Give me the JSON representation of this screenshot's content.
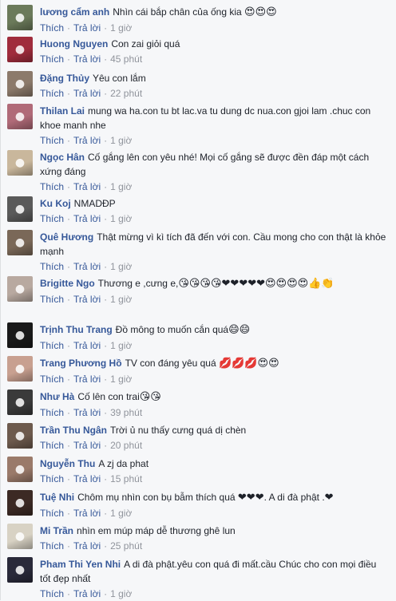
{
  "actions": {
    "like_label": "Thích",
    "reply_label": "Trả lời",
    "separator": "·"
  },
  "comments": [
    {
      "name": "lương cẩm anh",
      "text": "Nhìn cái bắp chân của ống kia",
      "emoji": "😍😍😍",
      "time": "1 giờ",
      "avatar_color": "#6b7a5a",
      "avatar_icon": "user-avatar-icon"
    },
    {
      "name": "Huong Nguyen",
      "text": "Con zai giỏi quá",
      "emoji": "",
      "time": "45 phút",
      "avatar_color": "#a02c3c",
      "avatar_icon": "user-avatar-icon"
    },
    {
      "name": "Đặng Thủy",
      "text": "Yêu con lắm",
      "emoji": "",
      "time": "22 phút",
      "avatar_color": "#8c7a6b",
      "avatar_icon": "user-avatar-icon"
    },
    {
      "name": "Thilan Lai",
      "text": "mung wa ha.con tu bt lac.va tu dung dc nua.con gjoi lam .chuc con khoe manh nhe",
      "emoji": "",
      "time": "1 giờ",
      "avatar_color": "#b06a78",
      "avatar_icon": "user-avatar-icon"
    },
    {
      "name": "Ngọc Hân",
      "text": "Cố gắng lên con yêu nhé! Mọi cố gắng sẽ được đền đáp một cách xứng đáng",
      "emoji": "",
      "time": "1 giờ",
      "avatar_color": "#c9b79c",
      "avatar_icon": "user-avatar-icon"
    },
    {
      "name": "Ku Koj",
      "text": "NMADĐP",
      "emoji": "",
      "time": "1 giờ",
      "avatar_color": "#5a5a5a",
      "avatar_icon": "user-avatar-icon"
    },
    {
      "name": "Quê Hương",
      "text": "Thật mừng vì kì tích đã đến với con. Cầu mong cho con thật là khỏe mạnh",
      "emoji": "",
      "time": "1 giờ",
      "avatar_color": "#7a6858",
      "avatar_icon": "user-avatar-icon"
    },
    {
      "name": "Brigitte Ngo",
      "text": "Thương e ,cưng e,",
      "emoji": "😘😘😘😘❤❤❤❤❤😍😍😍😍👍👏",
      "time": "1 giờ",
      "avatar_color": "#b8a9a0",
      "avatar_icon": "user-avatar-icon"
    },
    {
      "name": "Trịnh Thu Trang",
      "text": "Đồ mông to muốn cắn quá",
      "emoji": "😄😄",
      "time": "1 giờ",
      "avatar_color": "#1a1a1a",
      "avatar_icon": "user-avatar-icon"
    },
    {
      "name": "Trang Phương Hồ",
      "text": "TV con đáng yêu quá",
      "emoji": "💋💋💋😍😍",
      "time": "1 giờ",
      "avatar_color": "#c8a090",
      "avatar_icon": "user-avatar-icon"
    },
    {
      "name": "Như Hà",
      "text": "Cố lên con trai",
      "emoji": "😘😘",
      "time": "39 phút",
      "avatar_color": "#3a3a3a",
      "avatar_icon": "user-avatar-icon"
    },
    {
      "name": "Trần Thu Ngân",
      "text": "Trời ủ nu thấy cưng quá dị chèn",
      "emoji": "",
      "time": "20 phút",
      "avatar_color": "#6d5a4d",
      "avatar_icon": "user-avatar-icon"
    },
    {
      "name": "Nguyễn Thu",
      "text": "A zj da phat",
      "emoji": "",
      "time": "15 phút",
      "avatar_color": "#9a7a6a",
      "avatar_icon": "user-avatar-icon"
    },
    {
      "name": "Tuệ Nhi",
      "text": "Chôm mụ nhìn con bụ bẫm thích quá",
      "emoji": "❤❤❤",
      "text2": ". A di đà phật .",
      "emoji2": "❤",
      "time": "1 giờ",
      "avatar_color": "#3c2a24",
      "avatar_icon": "user-avatar-icon"
    },
    {
      "name": "Mi Trần",
      "text": "nhìn em múp máp dễ thương ghê lun",
      "emoji": "",
      "time": "25 phút",
      "avatar_color": "#d8d2c4",
      "avatar_icon": "user-avatar-icon"
    },
    {
      "name": "Pham Thi Yen Nhi",
      "text": "A di đà phật.yêu con quá đi mất.cầu Chúc cho con mọi điều tốt đẹp nhất",
      "emoji": "",
      "time": "1 giờ",
      "avatar_color": "#2a2a3a",
      "avatar_icon": "user-avatar-icon"
    }
  ]
}
